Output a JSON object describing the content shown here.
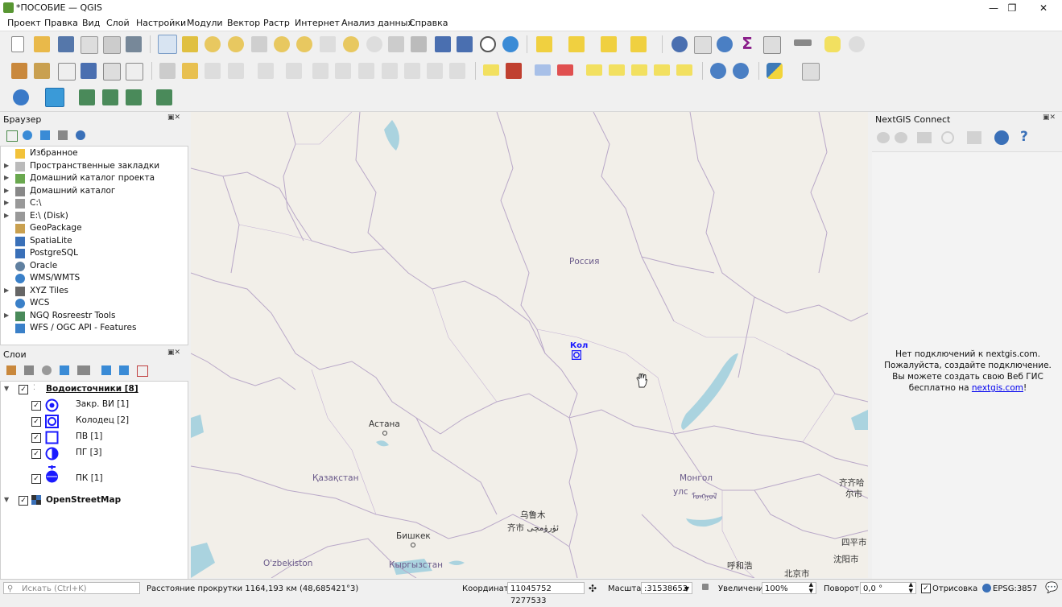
{
  "window": {
    "title": "*ПОСОБИЕ — QGIS",
    "minimize": "—",
    "maximize": "❐",
    "close": "✕"
  },
  "menu": [
    "Проект",
    "Правка",
    "Вид",
    "Слой",
    "Настройки",
    "Модули",
    "Вектор",
    "Растр",
    "Интернет",
    "Анализ данных",
    "Справка"
  ],
  "browser": {
    "title": "Браузер",
    "items": [
      {
        "label": "Избранное",
        "icon": "star-icon",
        "expand": false
      },
      {
        "label": "Пространственные закладки",
        "icon": "bookmark-icon",
        "expand": true
      },
      {
        "label": "Домашний каталог проекта",
        "icon": "project-folder-icon",
        "expand": true
      },
      {
        "label": "Домашний каталог",
        "icon": "home-folder-icon",
        "expand": true
      },
      {
        "label": "C:\\",
        "icon": "drive-icon",
        "expand": true
      },
      {
        "label": "E:\\ (Disk)",
        "icon": "drive-icon",
        "expand": true
      },
      {
        "label": "GeoPackage",
        "icon": "geopackage-icon",
        "expand": false
      },
      {
        "label": "SpatiaLite",
        "icon": "spatialite-icon",
        "expand": false
      },
      {
        "label": "PostgreSQL",
        "icon": "postgresql-icon",
        "expand": false
      },
      {
        "label": "Oracle",
        "icon": "oracle-icon",
        "expand": false
      },
      {
        "label": "WMS/WMTS",
        "icon": "globe-icon",
        "expand": false
      },
      {
        "label": "XYZ Tiles",
        "icon": "tiles-icon",
        "expand": true
      },
      {
        "label": "WCS",
        "icon": "globe-icon",
        "expand": false
      },
      {
        "label": "NGQ Rosreestr Tools",
        "icon": "plugin-icon",
        "expand": true
      },
      {
        "label": "WFS / OGC API - Features",
        "icon": "wfs-icon",
        "expand": false
      }
    ]
  },
  "layers": {
    "title": "Слои",
    "group1": "Водоисточники [8]",
    "items": [
      {
        "label": "Закр. ВИ [1]",
        "icon": "closed-source-symbol-icon"
      },
      {
        "label": "Колодец [2]",
        "icon": "well-symbol-icon"
      },
      {
        "label": "ПВ [1]",
        "icon": "square-symbol-icon"
      },
      {
        "label": "ПГ [3]",
        "icon": "half-circle-symbol-icon"
      },
      {
        "label": "ПК [1]",
        "icon": "pk-symbol-icon"
      }
    ],
    "group2": "OpenStreetMap"
  },
  "nextgis": {
    "title": "NextGIS Connect",
    "message": "Нет подключений к nextgis.com. Пожалуйста, создайте подключение. Вы можете создать свою Веб ГИС бесплатно на ",
    "link": "nextgis.com",
    "tail": "!"
  },
  "map": {
    "labels": {
      "russia": "Россия",
      "kol": "Кол",
      "astana": "Астана",
      "kazakhstan": "Қазақстан",
      "mongolia": "Монгол",
      "mongolia2": "улс",
      "mongolia3": "ᠮᠣᠩᠭᠣᠯ",
      "urumqi1": "乌鲁木",
      "urumqi2": "齐市 ئۈرۈمچى",
      "bishkek": "Бишкек",
      "kyrgyz": "Кыргызстан",
      "uzbek": "O'zbekiston",
      "hohhot": "呼和浩",
      "beijing": "北京市",
      "qiqihar1": "齐齐哈",
      "qiqihar2": "尔市",
      "siping": "四平市",
      "shenyang": "沈阳市"
    },
    "colors": {
      "land": "#f2efe9",
      "water": "#aad3df",
      "border": "#b9a8c8",
      "label": "#6a5a8a",
      "marker": "#1a1aff"
    }
  },
  "status": {
    "search_placeholder": "Искать (Ctrl+K)",
    "scroll_distance": "Расстояние прокрутки 1164,193 км (48,685421°3)",
    "coord_label": "Координаты",
    "coord_value": "11045752  7277533",
    "scale_label": "Масштаб",
    "scale_value": ":31538652",
    "zoom_label": "Увеличение",
    "zoom_value": "100%",
    "rotation_label": "Поворот",
    "rotation_value": "0,0 °",
    "render_label": "Отрисовка",
    "epsg": "EPSG:3857"
  }
}
